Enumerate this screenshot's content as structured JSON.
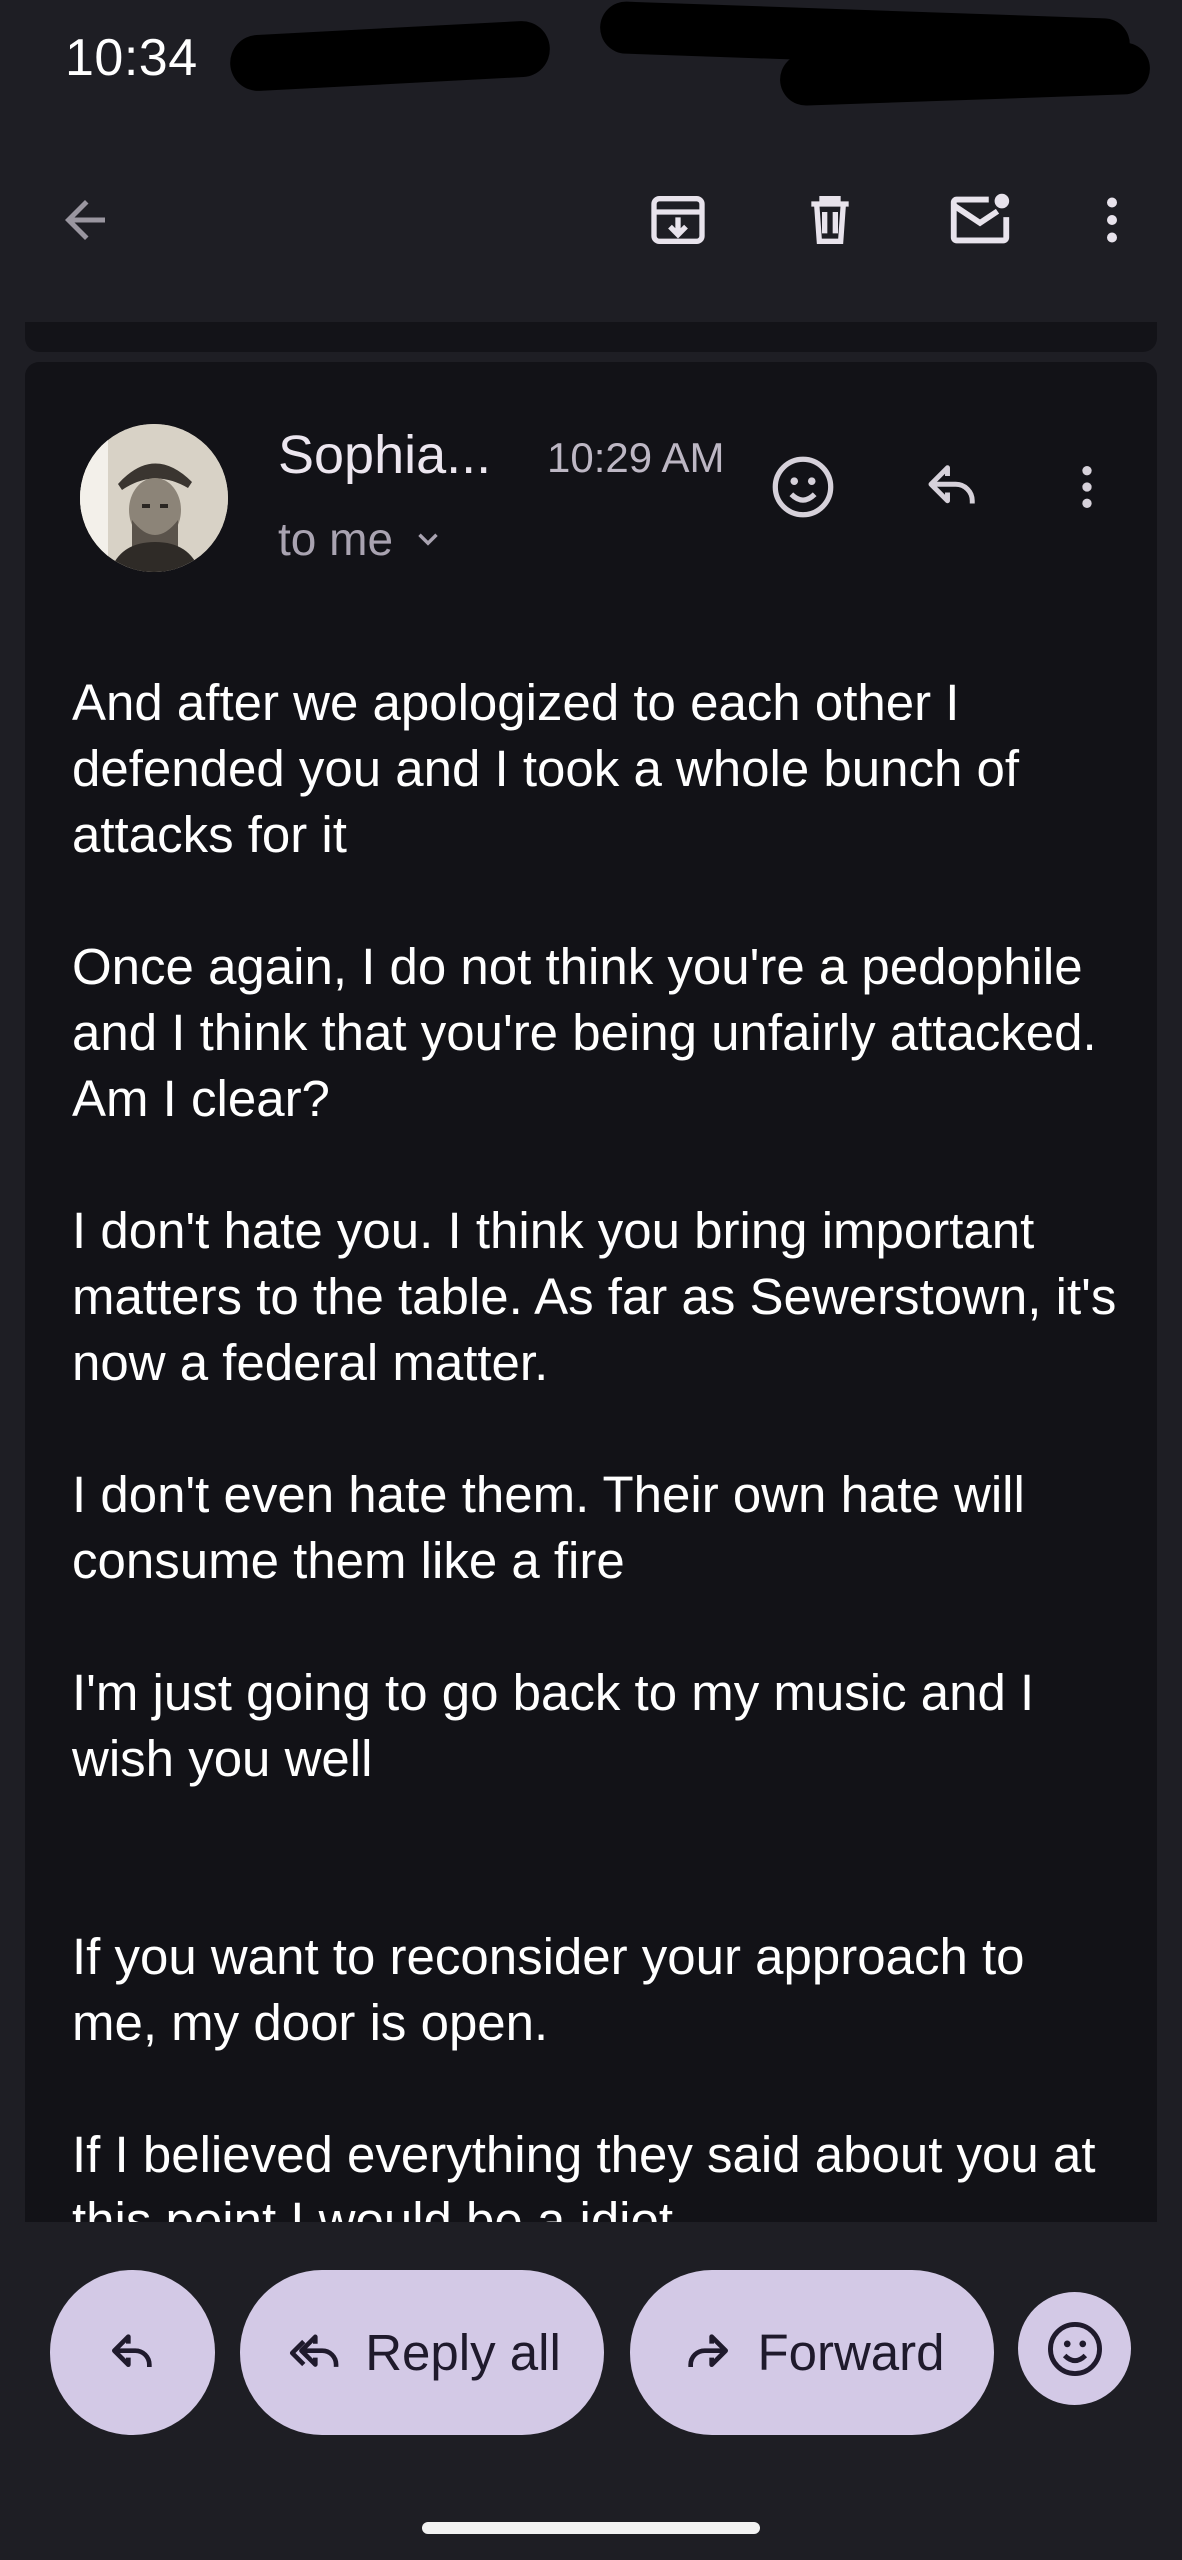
{
  "status_bar": {
    "time": "10:34"
  },
  "toolbar": {
    "back_icon": "arrow-left-icon",
    "archive_icon": "archive-icon",
    "delete_icon": "trash-icon",
    "mark_unread_icon": "mail-unread-icon",
    "more_icon": "more-vert-icon"
  },
  "message": {
    "sender": "Sophia...",
    "time": "10:29 AM",
    "recipient": "to me",
    "body": [
      "And after we apologized to each other I defended you and I took a whole bunch of attacks for it",
      "Once again, I do not think you're a pedophile and I think that you're being unfairly attacked. Am I clear?",
      "I don't hate you. I think you bring important matters to the table. As far as Sewerstown, it's now a federal matter.",
      "I don't even hate them. Their own hate will consume them like a fire",
      "I'm just going to go back to my music and I wish you well",
      "If you want to reconsider your approach to me, my door is open.",
      "If I believed everything they said about you at this point I would be a idiot"
    ]
  },
  "actions": {
    "reply_all": "Reply all",
    "forward": "Forward"
  },
  "colors": {
    "background": "#1e1e24",
    "card": "#121217",
    "pill": "#d3c9e6",
    "pill_text": "#1f1a2c"
  }
}
